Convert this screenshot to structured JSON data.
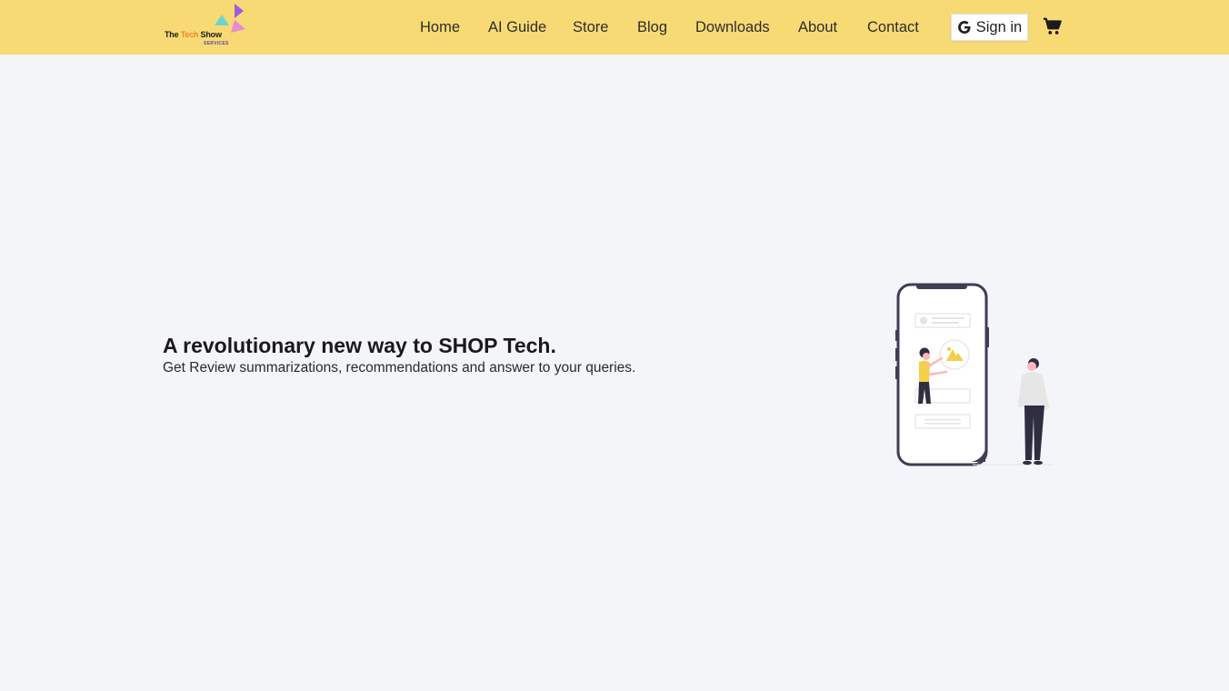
{
  "brand": {
    "name_main": "The ",
    "name_accent": "Tech",
    "name_end": " Show",
    "sub": "SERVICES",
    "colors": {
      "triangle_purple": "#9b5de5",
      "triangle_teal": "#6ed3cf",
      "triangle_pink": "#e88bd0"
    }
  },
  "nav": {
    "items": [
      {
        "label": "Home"
      },
      {
        "label": "AI Guide"
      },
      {
        "label": "Store"
      },
      {
        "label": "Blog"
      },
      {
        "label": "Downloads"
      },
      {
        "label": "About"
      },
      {
        "label": "Contact"
      }
    ],
    "signin_label": "Sign in",
    "signin_icon": "google-icon",
    "cart_icon": "shopping-cart-icon"
  },
  "hero": {
    "title": "A revolutionary new way to SHOP Tech.",
    "subtitle": "Get Review summarizations, recommendations and answer to your queries.",
    "illustration": "phone-people-illustration"
  },
  "theme": {
    "navbar_bg": "#f8da74",
    "page_bg": "#f4f5f8",
    "accent_yellow": "#f4cf4a",
    "dark_purple": "#3f3d56"
  }
}
